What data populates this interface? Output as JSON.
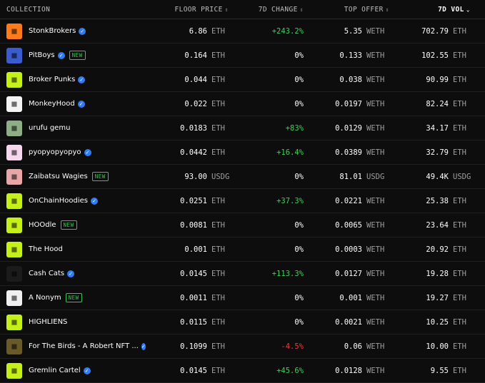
{
  "header": {
    "collection": "COLLECTION",
    "floor_price": "FLOOR PRICE",
    "change_7d": "7D CHANGE",
    "top_offer": "TOP OFFER",
    "vol_7d": "7D VOL"
  },
  "rows": [
    {
      "name": "StonkBrokers",
      "verified": true,
      "new": false,
      "floor": "6.86",
      "floor_unit": "ETH",
      "change": "+243.2%",
      "change_dir": "pos",
      "offer": "5.35",
      "offer_unit": "WETH",
      "vol": "702.79",
      "vol_unit": "ETH",
      "avatar_bg": "#ff7a1a",
      "avatar_icon": "briefcase-icon"
    },
    {
      "name": "PitBoys",
      "verified": true,
      "new": true,
      "floor": "0.164",
      "floor_unit": "ETH",
      "change": "0%",
      "change_dir": "zero",
      "offer": "0.133",
      "offer_unit": "WETH",
      "vol": "102.55",
      "vol_unit": "ETH",
      "avatar_bg": "#3b5ccf",
      "avatar_icon": "pitboy-face-icon"
    },
    {
      "name": "Broker Punks",
      "verified": true,
      "new": false,
      "floor": "0.044",
      "floor_unit": "ETH",
      "change": "0%",
      "change_dir": "zero",
      "offer": "0.038",
      "offer_unit": "WETH",
      "vol": "90.99",
      "vol_unit": "ETH",
      "avatar_bg": "#c6f01a",
      "avatar_icon": "punk-face-icon"
    },
    {
      "name": "MonkeyHood",
      "verified": true,
      "new": false,
      "floor": "0.022",
      "floor_unit": "ETH",
      "change": "0%",
      "change_dir": "zero",
      "offer": "0.0197",
      "offer_unit": "WETH",
      "vol": "82.24",
      "vol_unit": "ETH",
      "avatar_bg": "#f4f4f4",
      "avatar_icon": "monkeyhood-logo-icon"
    },
    {
      "name": "urufu gemu",
      "verified": false,
      "new": false,
      "floor": "0.0183",
      "floor_unit": "ETH",
      "change": "+83%",
      "change_dir": "pos",
      "offer": "0.0129",
      "offer_unit": "WETH",
      "vol": "34.17",
      "vol_unit": "ETH",
      "avatar_bg": "#8fae86",
      "avatar_icon": "wolf-icon"
    },
    {
      "name": "pyopyopyopyo",
      "verified": true,
      "new": false,
      "floor": "0.0442",
      "floor_unit": "ETH",
      "change": "+16.4%",
      "change_dir": "pos",
      "offer": "0.0389",
      "offer_unit": "WETH",
      "vol": "32.79",
      "vol_unit": "ETH",
      "avatar_bg": "#f7d7ee",
      "avatar_icon": "cup-icon"
    },
    {
      "name": "Zaibatsu Wagies",
      "verified": false,
      "new": true,
      "floor": "93.00",
      "floor_unit": "USDG",
      "change": "0%",
      "change_dir": "zero",
      "offer": "81.01",
      "offer_unit": "USDG",
      "vol": "49.4K",
      "vol_unit": "USDG",
      "avatar_bg": "#e8a6a6",
      "avatar_icon": "wagie-face-icon"
    },
    {
      "name": "OnChainHoodies",
      "verified": true,
      "new": false,
      "floor": "0.0251",
      "floor_unit": "ETH",
      "change": "+37.3%",
      "change_dir": "pos",
      "offer": "0.0221",
      "offer_unit": "WETH",
      "vol": "25.38",
      "vol_unit": "ETH",
      "avatar_bg": "#c6f01a",
      "avatar_icon": "hoodie-icon"
    },
    {
      "name": "HOOdle",
      "verified": false,
      "new": true,
      "floor": "0.0081",
      "floor_unit": "ETH",
      "change": "0%",
      "change_dir": "zero",
      "offer": "0.0065",
      "offer_unit": "WETH",
      "vol": "23.64",
      "vol_unit": "ETH",
      "avatar_bg": "#c6f01a",
      "avatar_icon": "hoodle-face-icon"
    },
    {
      "name": "The Hood",
      "verified": false,
      "new": false,
      "floor": "0.001",
      "floor_unit": "ETH",
      "change": "0%",
      "change_dir": "zero",
      "offer": "0.0003",
      "offer_unit": "WETH",
      "vol": "20.92",
      "vol_unit": "ETH",
      "avatar_bg": "#c6f01a",
      "avatar_icon": "hood-logo-icon"
    },
    {
      "name": "Cash Cats",
      "verified": true,
      "new": false,
      "floor": "0.0145",
      "floor_unit": "ETH",
      "change": "+113.3%",
      "change_dir": "pos",
      "offer": "0.0127",
      "offer_unit": "WETH",
      "vol": "19.28",
      "vol_unit": "ETH",
      "avatar_bg": "#1b1b1b",
      "avatar_icon": "cat-icon"
    },
    {
      "name": "A Nonym",
      "verified": false,
      "new": true,
      "floor": "0.0011",
      "floor_unit": "ETH",
      "change": "0%",
      "change_dir": "zero",
      "offer": "0.001",
      "offer_unit": "WETH",
      "vol": "19.27",
      "vol_unit": "ETH",
      "avatar_bg": "#f0f0f0",
      "avatar_icon": "anonymous-icon"
    },
    {
      "name": "HIGHLIENS",
      "verified": false,
      "new": false,
      "floor": "0.0115",
      "floor_unit": "ETH",
      "change": "0%",
      "change_dir": "zero",
      "offer": "0.0021",
      "offer_unit": "WETH",
      "vol": "10.25",
      "vol_unit": "ETH",
      "avatar_bg": "#c6f01a",
      "avatar_icon": "alien-icon"
    },
    {
      "name": "For The Birds - A Robert NFT ...",
      "verified": true,
      "new": false,
      "floor": "0.1099",
      "floor_unit": "ETH",
      "change": "-4.5%",
      "change_dir": "neg",
      "offer": "0.06",
      "offer_unit": "WETH",
      "vol": "10.00",
      "vol_unit": "ETH",
      "avatar_bg": "#6a5a2a",
      "avatar_icon": "bird-icon"
    },
    {
      "name": "Gremlin Cartel",
      "verified": true,
      "new": false,
      "floor": "0.0145",
      "floor_unit": "ETH",
      "change": "+45.6%",
      "change_dir": "pos",
      "offer": "0.0128",
      "offer_unit": "WETH",
      "vol": "9.55",
      "vol_unit": "ETH",
      "avatar_bg": "#c6f01a",
      "avatar_icon": "gremlin-icon"
    }
  ],
  "badges": {
    "new_label": "NEW",
    "verified_glyph": "✓"
  },
  "colors": {
    "positive": "#3fcf5a",
    "negative": "#ef3b3b",
    "new_badge": "#37c455",
    "verified": "#2f7cf6"
  }
}
